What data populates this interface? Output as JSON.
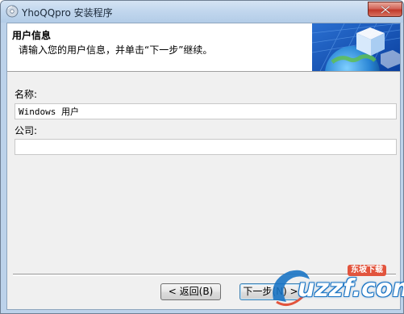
{
  "window": {
    "title": "YhoQQpro 安装程序",
    "icon": "installer-disc-icon"
  },
  "header": {
    "title": "用户信息",
    "subtitle": "请输入您的用户信息，并单击“下一步”继续。",
    "graphic": "globe-cube-graphic"
  },
  "form": {
    "name_label": "名称:",
    "name_value": "Windows 用户",
    "company_label": "公司:",
    "company_value": ""
  },
  "buttons": {
    "back_label": "< 返回(B)",
    "next_label": "下一步(N) >"
  },
  "watermark": {
    "text": "uzzf.com",
    "badge": "东坡下载"
  },
  "colors": {
    "accent": "#1a74c4",
    "close_red": "#c0392b",
    "client_bg": "#f0f0f0"
  }
}
